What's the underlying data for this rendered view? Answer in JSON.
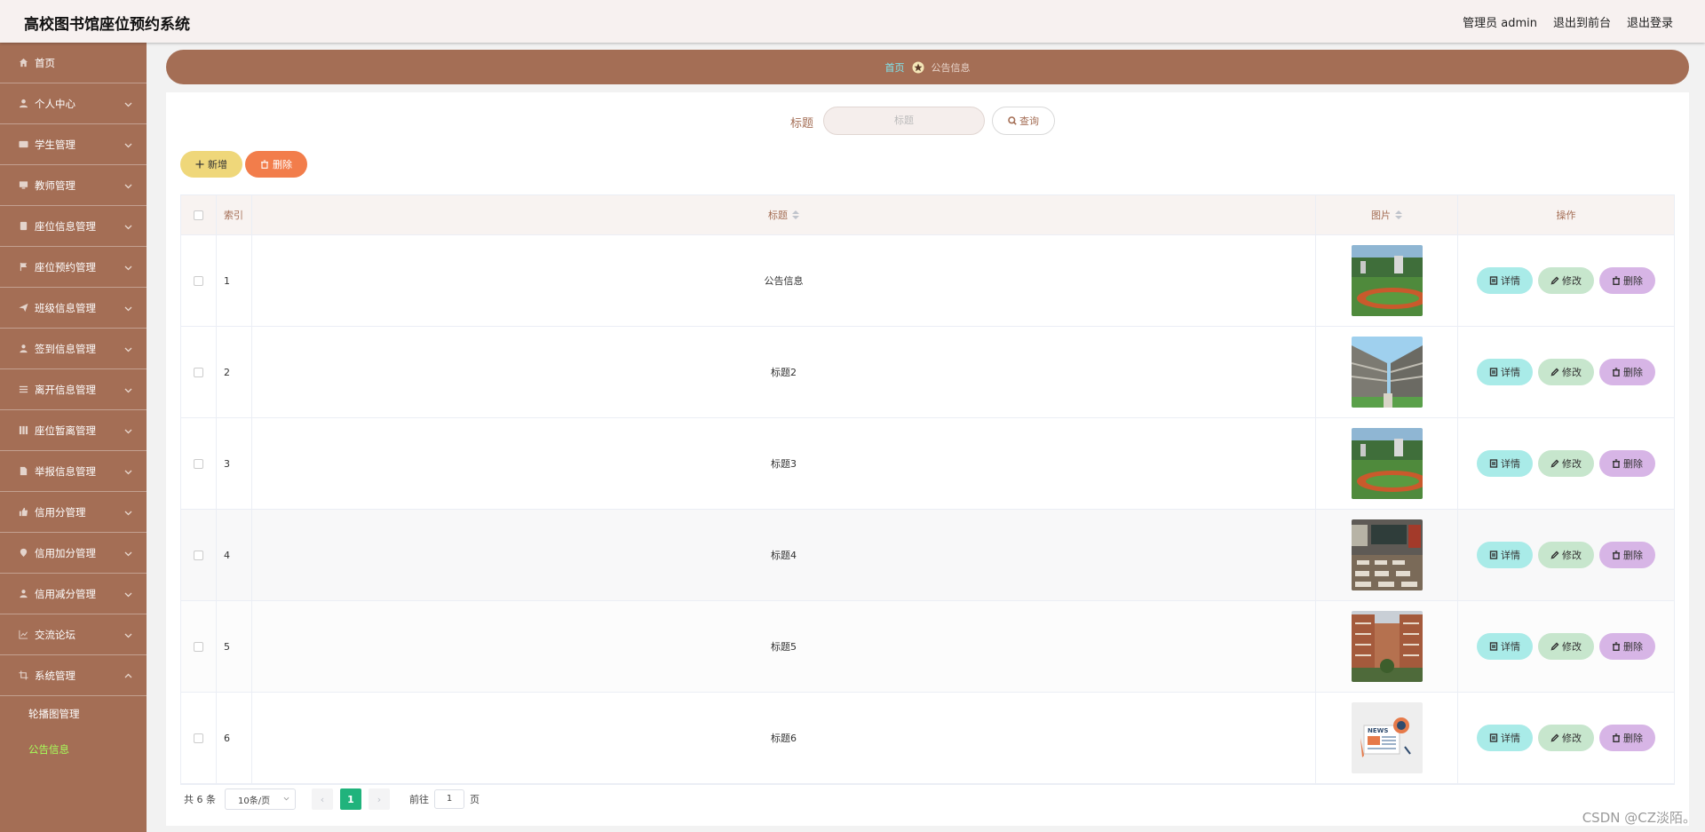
{
  "header": {
    "title": "高校图书馆座位预约系统",
    "user_label": "管理员 admin",
    "front_label": "退出到前台",
    "logout_label": "退出登录"
  },
  "sidebar": {
    "items": [
      {
        "label": "首页",
        "icon": "home-icon",
        "has_arrow": false
      },
      {
        "label": "个人中心",
        "icon": "user-icon",
        "has_arrow": true
      },
      {
        "label": "学生管理",
        "icon": "id-card-icon",
        "has_arrow": true
      },
      {
        "label": "教师管理",
        "icon": "monitor-icon",
        "has_arrow": true
      },
      {
        "label": "座位信息管理",
        "icon": "document-icon",
        "has_arrow": true
      },
      {
        "label": "座位预约管理",
        "icon": "flag-icon",
        "has_arrow": true
      },
      {
        "label": "班级信息管理",
        "icon": "send-icon",
        "has_arrow": true
      },
      {
        "label": "签到信息管理",
        "icon": "person-icon",
        "has_arrow": true
      },
      {
        "label": "离开信息管理",
        "icon": "menu-icon",
        "has_arrow": true
      },
      {
        "label": "座位暂离管理",
        "icon": "grid-icon",
        "has_arrow": true
      },
      {
        "label": "举报信息管理",
        "icon": "file-icon",
        "has_arrow": true
      },
      {
        "label": "信用分管理",
        "icon": "thumb-icon",
        "has_arrow": true
      },
      {
        "label": "信用加分管理",
        "icon": "location-icon",
        "has_arrow": true
      },
      {
        "label": "信用减分管理",
        "icon": "person-icon",
        "has_arrow": true
      },
      {
        "label": "交流论坛",
        "icon": "chart-icon",
        "has_arrow": true
      },
      {
        "label": "系统管理",
        "icon": "crop-icon",
        "has_arrow": true,
        "expanded": true
      }
    ],
    "subitems": [
      {
        "label": "轮播图管理",
        "active": false
      },
      {
        "label": "公告信息",
        "active": true
      }
    ]
  },
  "breadcrumb": {
    "home": "首页",
    "current": "公告信息"
  },
  "search": {
    "label": "标题",
    "placeholder": "标题",
    "button": "查询"
  },
  "actions": {
    "add": "新增",
    "delete": "删除"
  },
  "table": {
    "headers": {
      "index": "索引",
      "title": "标题",
      "image": "图片",
      "ops": "操作"
    },
    "rows": [
      {
        "index": "1",
        "title": "公告信息",
        "image": "track-field"
      },
      {
        "index": "2",
        "title": "标题2",
        "image": "campus-building"
      },
      {
        "index": "3",
        "title": "标题3",
        "image": "track-field"
      },
      {
        "index": "4",
        "title": "标题4",
        "image": "classroom"
      },
      {
        "index": "5",
        "title": "标题5",
        "image": "brick-building"
      },
      {
        "index": "6",
        "title": "标题6",
        "image": "news-graphic"
      }
    ],
    "ops": {
      "detail": "详情",
      "edit": "修改",
      "delete": "删除"
    }
  },
  "pagination": {
    "total": "共 6 条",
    "page_size": "10条/页",
    "current_page": "1",
    "goto_prefix": "前往",
    "goto_value": "1",
    "goto_suffix": "页"
  },
  "watermark": "CSDN @CZ淡陌。",
  "colors": {
    "sidebar": "#a46e55",
    "header": "#f7f1f0",
    "add_button": "#efd77a",
    "delete_button": "#f27d4b",
    "detail_button": "#a9ebe8",
    "edit_button": "#c7e6cd",
    "row_delete_button": "#d7b5e6",
    "active_page": "#20b37c",
    "active_submenu": "#a6ff5a"
  }
}
